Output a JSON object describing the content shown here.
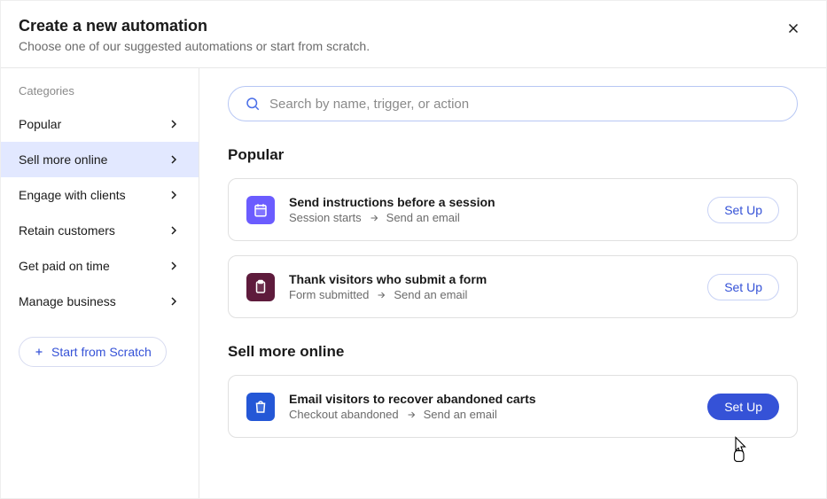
{
  "header": {
    "title": "Create a new automation",
    "subtitle": "Choose one of our suggested automations or start from scratch."
  },
  "sidebar": {
    "categories_label": "Categories",
    "items": [
      {
        "label": "Popular",
        "active": false
      },
      {
        "label": "Sell more online",
        "active": true
      },
      {
        "label": "Engage with clients",
        "active": false
      },
      {
        "label": "Retain customers",
        "active": false
      },
      {
        "label": "Get paid on time",
        "active": false
      },
      {
        "label": "Manage business",
        "active": false
      }
    ],
    "scratch_label": "Start from Scratch"
  },
  "search": {
    "placeholder": "Search by name, trigger, or action"
  },
  "buttons": {
    "setup": "Set Up"
  },
  "sections": [
    {
      "title": "Popular",
      "cards": [
        {
          "icon": "calendar",
          "title": "Send instructions before a session",
          "trigger": "Session starts",
          "action": "Send an email",
          "primary": false
        },
        {
          "icon": "form",
          "title": "Thank visitors who submit a form",
          "trigger": "Form submitted",
          "action": "Send an email",
          "primary": false
        }
      ]
    },
    {
      "title": "Sell more online",
      "cards": [
        {
          "icon": "bag",
          "title": "Email visitors to recover abandoned carts",
          "trigger": "Checkout abandoned",
          "action": "Send an email",
          "primary": true
        }
      ]
    }
  ]
}
